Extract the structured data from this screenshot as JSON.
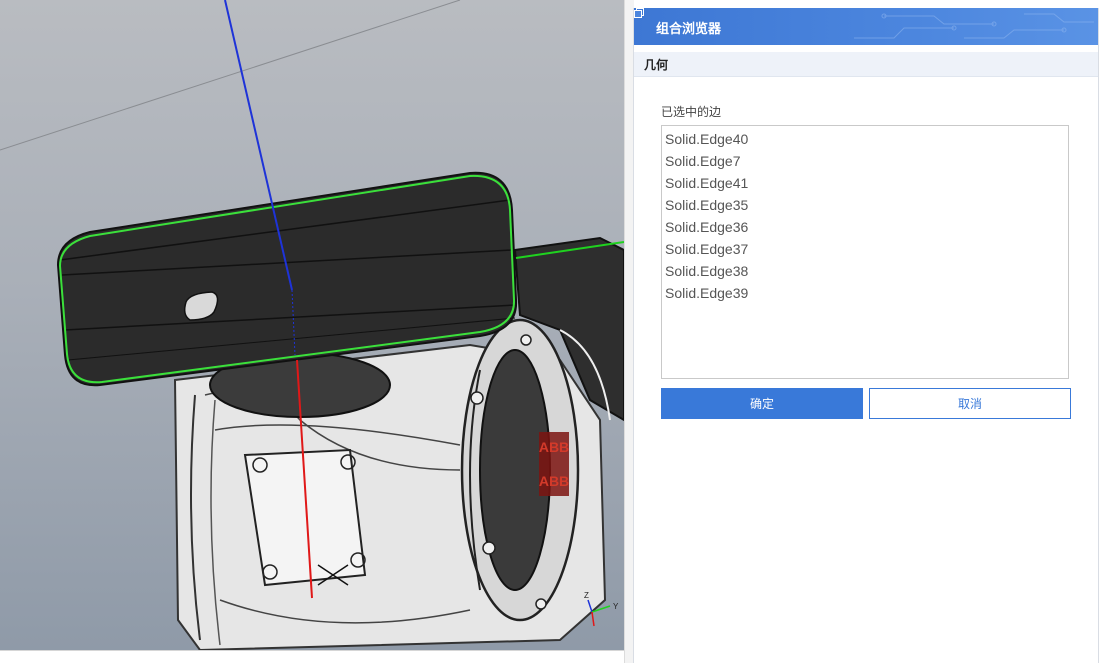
{
  "panel": {
    "title": "组合浏览器",
    "float_icon": "restore-window-icon",
    "section": "几何",
    "edges_label": "已选中的边",
    "edges": [
      "Solid.Edge40",
      "Solid.Edge7",
      "Solid.Edge41",
      "Solid.Edge35",
      "Solid.Edge36",
      "Solid.Edge37",
      "Solid.Edge38",
      "Solid.Edge39"
    ],
    "ok_label": "确定",
    "cancel_label": "取消"
  },
  "viewport": {
    "axis_labels": {
      "z": "Z",
      "y": "Y"
    },
    "logo_text": "ABB",
    "colors": {
      "selection_edge": "#3be03b",
      "z_axis": "#1e33d8",
      "x_axis": "#e01818",
      "y_axis": "#1fd21f",
      "flange": "#2a2a2a",
      "logo": "#b8261e"
    }
  },
  "theme": {
    "accent": "#3979d9",
    "header": "#3d77d4"
  }
}
